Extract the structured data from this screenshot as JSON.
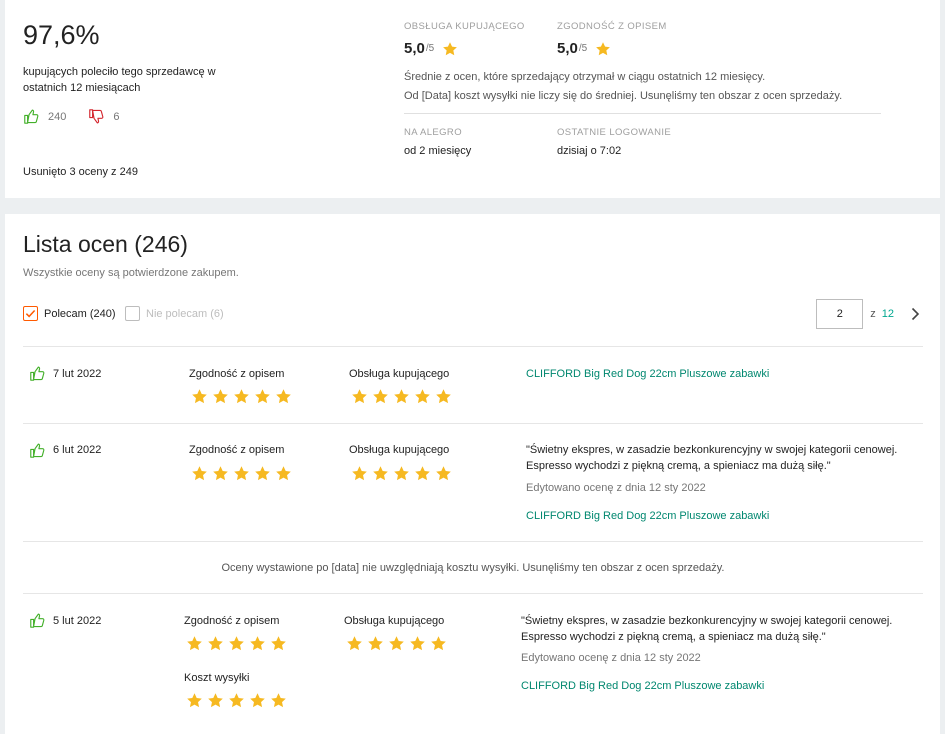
{
  "summary": {
    "percent": "97,6%",
    "recommend_text": "kupujących poleciło tego sprzedawcę w ostatnich 12 miesiącach",
    "positive_count": "240",
    "negative_count": "6",
    "removed_text": "Usunięto 3 oceny z 249",
    "service_caption": "OBSŁUGA KUPUJĄCEGO",
    "service_score": "5,0",
    "service_out_of": "/5",
    "accuracy_caption": "ZGODNOŚĆ Z OPISEM",
    "accuracy_score": "5,0",
    "accuracy_out_of": "/5",
    "avg_note": "Średnie z ocen, które sprzedający otrzymał w ciągu ostatnich 12 miesięcy.",
    "shipping_note": "Od [Data] koszt wysyłki nie liczy się do średniej. Usunęliśmy ten obszar z ocen sprzedaży.",
    "on_allegro_caption": "NA ALEGRO",
    "on_allegro_value": "od 2 miesięcy",
    "last_login_caption": "OSTATNIE LOGOWANIE",
    "last_login_value": "dzisiaj o 7:02"
  },
  "list": {
    "title": "Lista ocen (246)",
    "subtitle": "Wszystkie oceny są potwierdzone zakupem.",
    "filter_recommend": "Polecam (240)",
    "filter_not_recommend": "Nie polecam (6)",
    "page_value": "2",
    "page_of": "z",
    "page_total": "12",
    "info_banner": "Oceny wystawione po [data] nie uwzględniają kosztu wysyłki. Usunęliśmy ten obszar z ocen sprzedaży.",
    "reviews": [
      {
        "date": "7 lut 2022",
        "accuracy_label": "Zgodność z opisem",
        "accuracy_rating": 5,
        "service_label": "Obsługa kupującego",
        "service_rating": 5,
        "product": "CLIFFORD Big Red Dog 22cm Pluszowe zabawki"
      },
      {
        "date": "6 lut 2022",
        "accuracy_label": "Zgodność z opisem",
        "accuracy_rating": 5,
        "service_label": "Obsługa kupującego",
        "service_rating": 5,
        "comment": "\"Świetny ekspres, w zasadzie bezkonkurencyjny w swojej kategorii cenowej. Espresso wychodzi z piękną cremą, a spieniacz ma dużą siłę.\"",
        "edited": "Edytowano ocenę z dnia 12 sty 2022",
        "product": "CLIFFORD Big Red Dog 22cm Pluszowe zabawki"
      },
      {
        "date": "5 lut 2022",
        "accuracy_label": "Zgodność z opisem",
        "accuracy_rating": 5,
        "service_label": "Obsługa kupującego",
        "service_rating": 5,
        "shipping_label": "Koszt wysyłki",
        "shipping_rating": 5,
        "comment": "\"Świetny ekspres, w zasadzie bezkonkurencyjny w swojej kategorii cenowej. Espresso wychodzi z piękną cremą, a spieniacz ma dużą siłę.\"",
        "edited": "Edytowano ocenę z dnia 12 sty 2022",
        "product": "CLIFFORD Big Red Dog 22cm Pluszowe zabawki"
      }
    ]
  },
  "colors": {
    "accent": "#ff5a00",
    "positive": "#43b02a",
    "negative": "#d4262e",
    "star": "#f6b921",
    "link": "#00876f"
  }
}
